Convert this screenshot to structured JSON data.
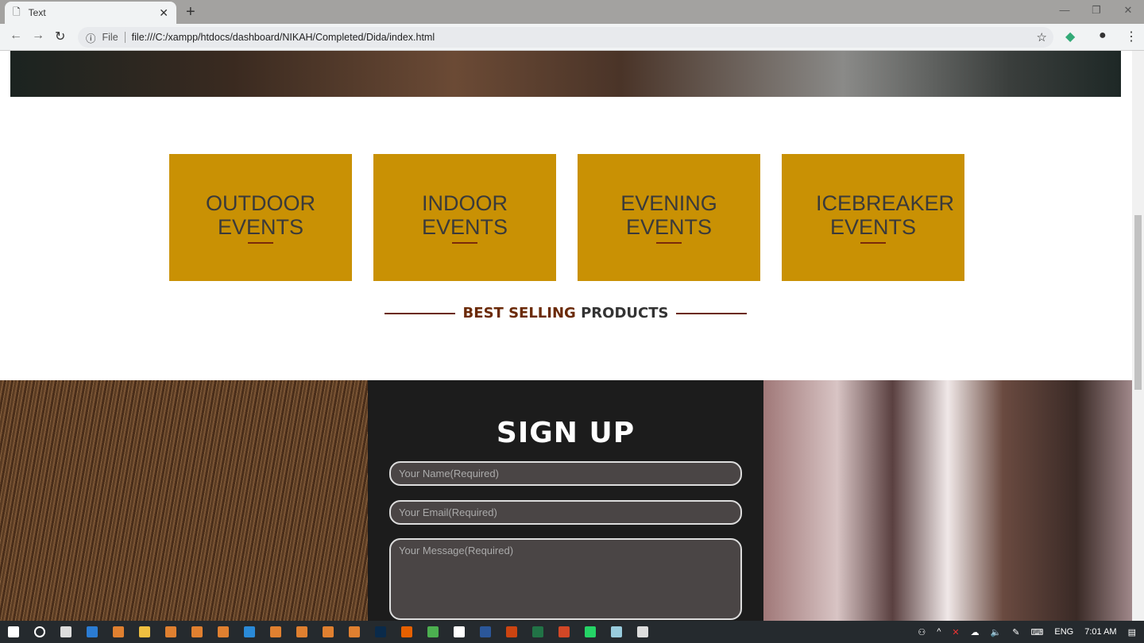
{
  "browser": {
    "tab_title": "Text",
    "url_scheme": "File",
    "url": "file:///C:/xampp/htdocs/dashboard/NIKAH/Completed/Dida/index.html"
  },
  "events": [
    {
      "line1": "OUTDOOR",
      "line2": "EVENTS"
    },
    {
      "line1": "INDOOR",
      "line2": "EVENTS"
    },
    {
      "line1": "EVENING",
      "line2": "EVENTS"
    },
    {
      "line1": "ICEBREAKER",
      "line2": "EVENTS"
    }
  ],
  "section": {
    "part1": "BEST SELLING",
    "part2": "PRODUCTS"
  },
  "signup": {
    "title": "SIGN UP",
    "name_placeholder": "Your Name(Required)",
    "email_placeholder": "Your Email(Required)",
    "message_placeholder": "Your Message(Required)"
  },
  "colors": {
    "card": "#c99104",
    "accent": "#6b2a08",
    "panel": "#1c1c1c"
  },
  "taskbar": {
    "apps": [
      "start",
      "search",
      "task-view",
      "edge",
      "app",
      "file-explorer",
      "app",
      "app",
      "app",
      "vscode",
      "app",
      "app",
      "app",
      "app",
      "photoshop",
      "firefox",
      "chrome",
      "store",
      "word",
      "acrobat",
      "excel",
      "powerpoint",
      "whatsapp",
      "notepad",
      "photos"
    ],
    "lang": "ENG",
    "time": "7:01 AM"
  }
}
